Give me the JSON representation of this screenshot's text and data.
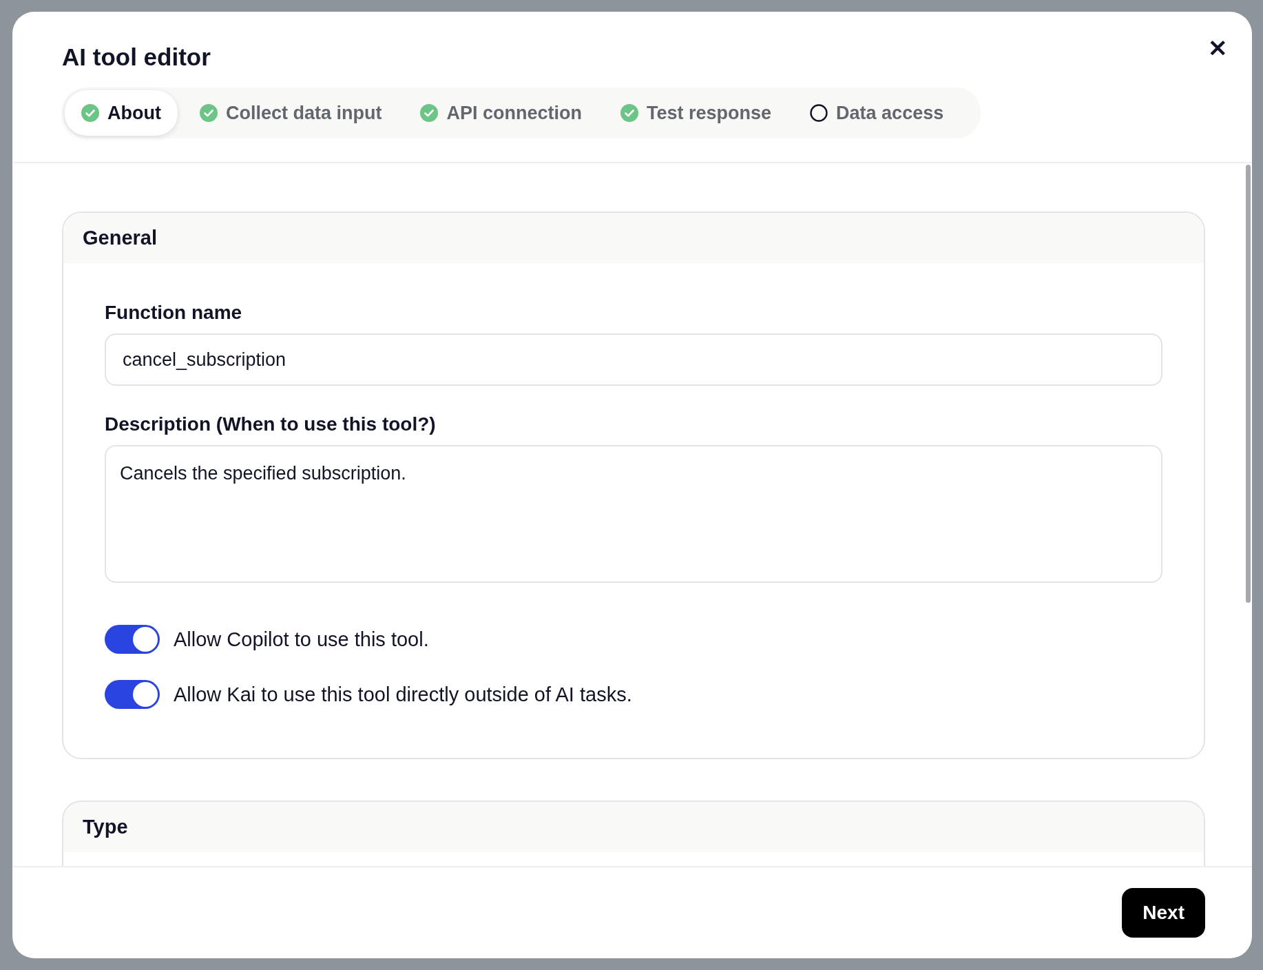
{
  "dialog": {
    "title": "AI tool editor",
    "close_label": "✕"
  },
  "steps": [
    {
      "label": "About",
      "complete": true,
      "selected": true
    },
    {
      "label": "Collect data input",
      "complete": true,
      "selected": false
    },
    {
      "label": "API connection",
      "complete": true,
      "selected": false
    },
    {
      "label": "Test response",
      "complete": true,
      "selected": false
    },
    {
      "label": "Data access",
      "complete": false,
      "selected": false
    }
  ],
  "sections": [
    {
      "title": "General",
      "fields": [
        {
          "kind": "input",
          "label": "Function name",
          "value": "cancel_subscription"
        },
        {
          "kind": "textarea",
          "label": "Description (When to use this tool?)",
          "value": "Cancels the specified subscription."
        }
      ],
      "toggles": [
        {
          "label": "Allow Copilot to use this tool.",
          "on": true
        },
        {
          "label": "Allow Kai to use this tool directly outside of AI tasks.",
          "on": true
        }
      ]
    },
    {
      "title": "Type"
    }
  ],
  "footer": {
    "next_button": "Next"
  }
}
